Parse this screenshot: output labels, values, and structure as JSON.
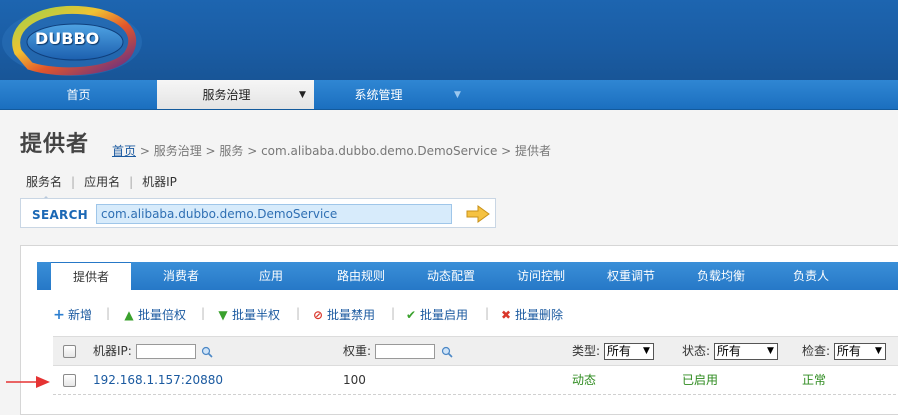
{
  "brand": {
    "logo_text": "DUBBO"
  },
  "nav": {
    "items": [
      {
        "label": "首页"
      },
      {
        "label": "服务治理",
        "caret": "▼"
      },
      {
        "label": "系统管理",
        "caret": "▼"
      }
    ]
  },
  "page": {
    "title": "提供者",
    "breadcrumb": {
      "home": "首页",
      "rest": " > 服务治理 > 服务 > com.alibaba.dubbo.demo.DemoService > 提供者"
    }
  },
  "search": {
    "tabs": [
      "服务名",
      "应用名",
      "机器IP"
    ],
    "label": "SEARCH",
    "value": "com.alibaba.dubbo.demo.DemoService"
  },
  "tabs": [
    "提供者",
    "消费者",
    "应用",
    "路由规则",
    "动态配置",
    "访问控制",
    "权重调节",
    "负载均衡",
    "负责人"
  ],
  "toolbar": {
    "add": "新增",
    "double": "批量倍权",
    "half": "批量半权",
    "disable": "批量禁用",
    "enable": "批量启用",
    "delete": "批量删除"
  },
  "table": {
    "headers": {
      "ip": "机器IP:",
      "weight": "权重:",
      "type": "类型:",
      "status": "状态:",
      "check": "检查:"
    },
    "filters": {
      "type": "所有",
      "status": "所有",
      "check": "所有"
    },
    "rows": [
      {
        "ip": "192.168.1.157:20880",
        "weight": "100",
        "type": "动态",
        "status": "已启用",
        "check": "正常"
      }
    ]
  },
  "colors": {
    "brand_blue": "#1a5ca3",
    "nav_blue": "#2678c7",
    "link": "#1b5aa0",
    "ok_green": "#2e8b1f"
  }
}
